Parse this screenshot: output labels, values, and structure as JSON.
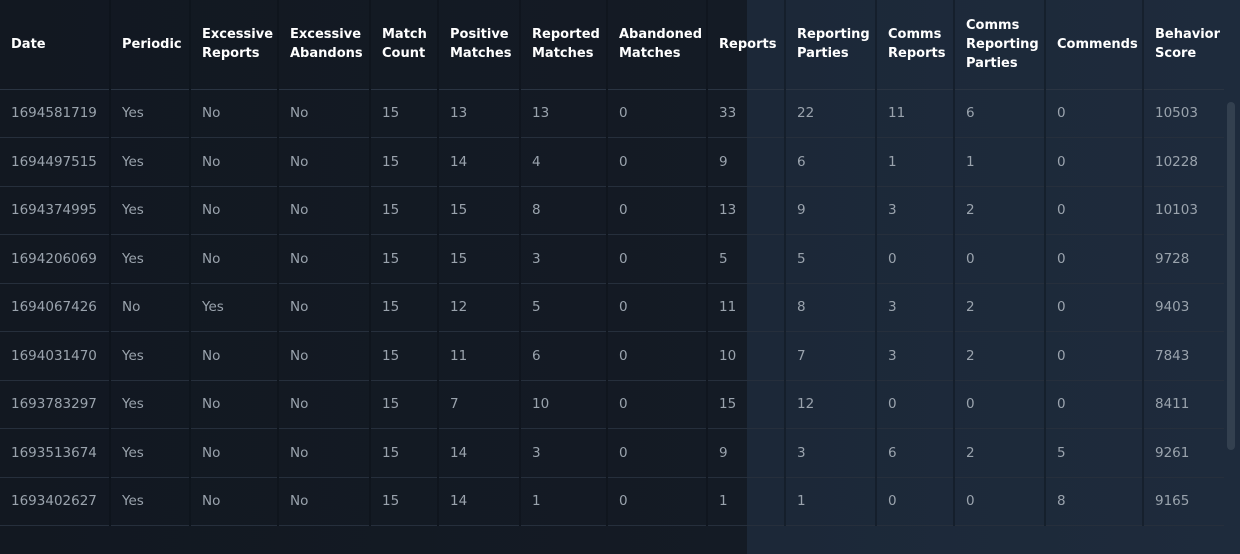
{
  "table": {
    "columns": [
      "Date",
      "Periodic",
      "Excessive Reports",
      "Excessive Abandons",
      "Match Count",
      "Positive Matches",
      "Reported Matches",
      "Abandoned Matches",
      "Reports",
      "Reporting Parties",
      "Comms Reports",
      "Comms Reporting Parties",
      "Commends",
      "Behavior Score"
    ],
    "rows": [
      [
        "1694581719",
        "Yes",
        "No",
        "No",
        "15",
        "13",
        "13",
        "0",
        "33",
        "22",
        "11",
        "6",
        "0",
        "10503"
      ],
      [
        "1694497515",
        "Yes",
        "No",
        "No",
        "15",
        "14",
        "4",
        "0",
        "9",
        "6",
        "1",
        "1",
        "0",
        "10228"
      ],
      [
        "1694374995",
        "Yes",
        "No",
        "No",
        "15",
        "15",
        "8",
        "0",
        "13",
        "9",
        "3",
        "2",
        "0",
        "10103"
      ],
      [
        "1694206069",
        "Yes",
        "No",
        "No",
        "15",
        "15",
        "3",
        "0",
        "5",
        "5",
        "0",
        "0",
        "0",
        "9728"
      ],
      [
        "1694067426",
        "No",
        "Yes",
        "No",
        "15",
        "12",
        "5",
        "0",
        "11",
        "8",
        "3",
        "2",
        "0",
        "9403"
      ],
      [
        "1694031470",
        "Yes",
        "No",
        "No",
        "15",
        "11",
        "6",
        "0",
        "10",
        "7",
        "3",
        "2",
        "0",
        "7843"
      ],
      [
        "1693783297",
        "Yes",
        "No",
        "No",
        "15",
        "7",
        "10",
        "0",
        "15",
        "12",
        "0",
        "0",
        "0",
        "8411"
      ],
      [
        "1693513674",
        "Yes",
        "No",
        "No",
        "15",
        "14",
        "3",
        "0",
        "9",
        "3",
        "6",
        "2",
        "5",
        "9261"
      ],
      [
        "1693402627",
        "Yes",
        "No",
        "No",
        "15",
        "14",
        "1",
        "0",
        "1",
        "1",
        "0",
        "0",
        "8",
        "9165"
      ]
    ]
  }
}
